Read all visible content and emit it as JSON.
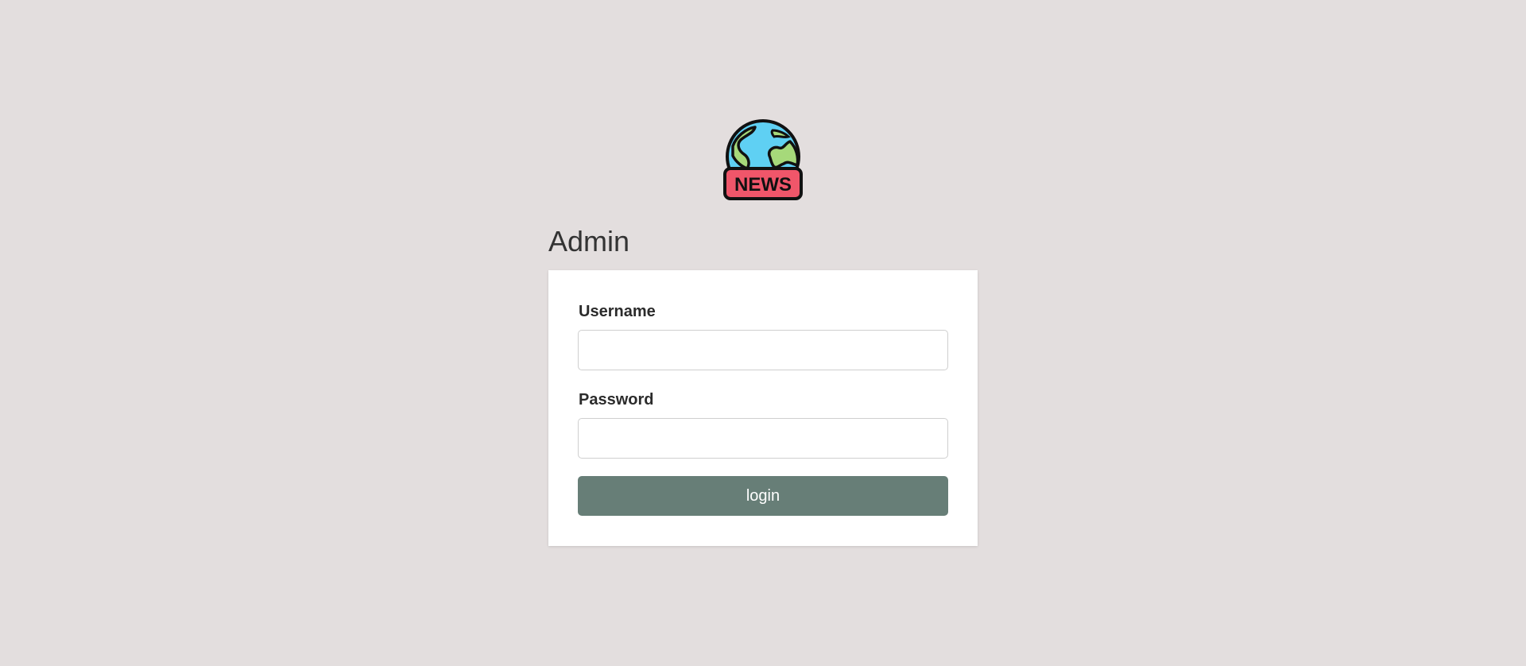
{
  "logo": {
    "icon": "globe-news-icon",
    "text": "NEWS",
    "colors": {
      "ocean": "#5fd0f3",
      "land": "#a6d97a",
      "banner": "#f0566a",
      "outline": "#111111"
    }
  },
  "page": {
    "title": "Admin",
    "background": "#e3dede"
  },
  "form": {
    "username_label": "Username",
    "username_value": "",
    "username_placeholder": "",
    "password_label": "Password",
    "password_value": "",
    "password_placeholder": "",
    "submit_label": "login",
    "submit_color": "#677e77"
  }
}
